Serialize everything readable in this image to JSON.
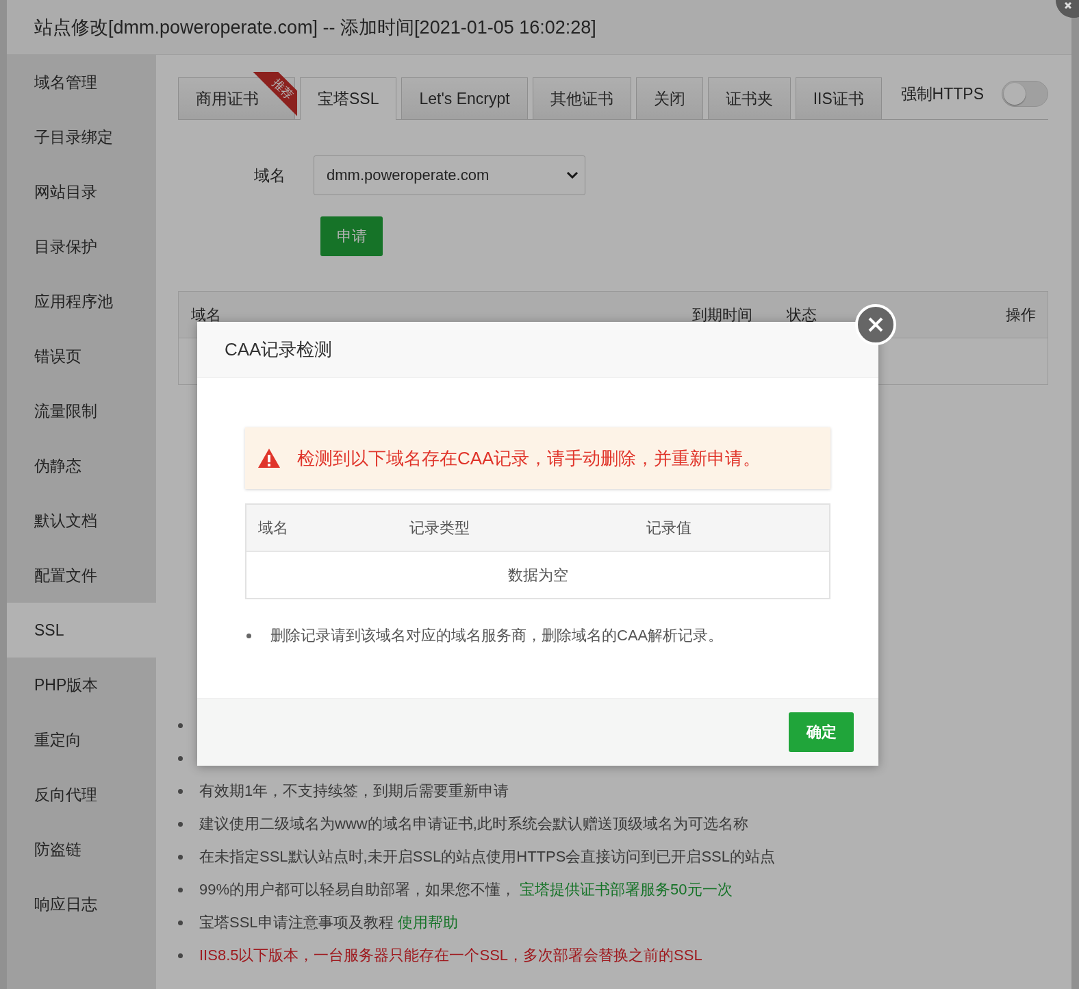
{
  "window": {
    "title": "站点修改[dmm.poweroperate.com] -- 添加时间[2021-01-05 16:02:28]"
  },
  "sidebar": {
    "items": [
      {
        "label": "域名管理",
        "selected": false
      },
      {
        "label": "子目录绑定",
        "selected": false
      },
      {
        "label": "网站目录",
        "selected": false
      },
      {
        "label": "目录保护",
        "selected": false
      },
      {
        "label": "应用程序池",
        "selected": false
      },
      {
        "label": "错误页",
        "selected": false
      },
      {
        "label": "流量限制",
        "selected": false
      },
      {
        "label": "伪静态",
        "selected": false
      },
      {
        "label": "默认文档",
        "selected": false
      },
      {
        "label": "配置文件",
        "selected": false
      },
      {
        "label": "SSL",
        "selected": true
      },
      {
        "label": "PHP版本",
        "selected": false
      },
      {
        "label": "重定向",
        "selected": false
      },
      {
        "label": "反向代理",
        "selected": false
      },
      {
        "label": "防盗链",
        "selected": false
      },
      {
        "label": "响应日志",
        "selected": false
      }
    ]
  },
  "tabs": [
    {
      "label": "商用证书",
      "selected": false,
      "ribbon": "推荐"
    },
    {
      "label": "宝塔SSL",
      "selected": true
    },
    {
      "label": "Let's Encrypt",
      "selected": false
    },
    {
      "label": "其他证书",
      "selected": false
    },
    {
      "label": "关闭",
      "selected": false
    },
    {
      "label": "证书夹",
      "selected": false
    },
    {
      "label": "IIS证书",
      "selected": false
    }
  ],
  "force_https": {
    "label": "强制HTTPS",
    "on": false
  },
  "form": {
    "domain_label": "域名",
    "domain_value": "dmm.poweroperate.com",
    "apply_button": "申请"
  },
  "table": {
    "columns": [
      "域名",
      "到期时间",
      "状态",
      "操作"
    ]
  },
  "notes": [
    {
      "kind": "plain",
      "text": "有效期1年，不支持续签，到期后需要重新申请"
    },
    {
      "kind": "plain",
      "text": "建议使用二级域名为www的域名申请证书,此时系统会默认赠送顶级域名为可选名称"
    },
    {
      "kind": "plain",
      "text": "在未指定SSL默认站点时,未开启SSL的站点使用HTTPS会直接访问到已开启SSL的站点"
    },
    {
      "kind": "plain",
      "text": "99%的用户都可以轻易自助部署，如果您不懂，",
      "link": "宝塔提供证书部署服务50元一次"
    },
    {
      "kind": "plain",
      "text": "宝塔SSL申请注意事项及教程",
      "link": "使用帮助"
    },
    {
      "kind": "warning",
      "text": "IIS8.5以下版本，一台服务器只能存在一个SSL，多次部署会替换之前的SSL"
    }
  ],
  "dialog": {
    "title": "CAA记录检测",
    "alert": "检测到以下域名存在CAA记录，请手动删除，并重新申请。",
    "table": {
      "columns": [
        "域名",
        "记录类型",
        "记录值"
      ],
      "empty_text": "数据为空"
    },
    "note": "删除记录请到该域名对应的域名服务商，删除域名的CAA解析记录。",
    "confirm_button": "确定"
  }
}
